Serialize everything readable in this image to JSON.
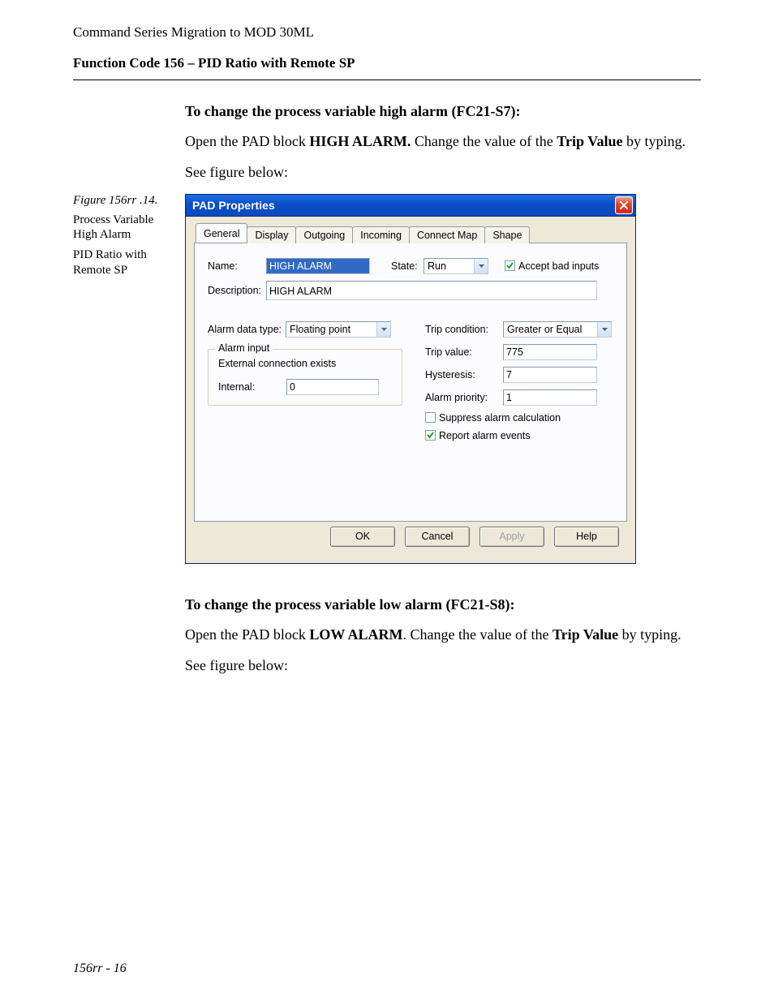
{
  "doc": {
    "header": "Command Series Migration to MOD 30ML",
    "section": "Function Code 156 – PID Ratio with Remote SP",
    "footer": "156rr - 16"
  },
  "highAlarm": {
    "heading": "To change the process variable high alarm (FC21-S7):",
    "para_pre": "Open the PAD block ",
    "para_bold1": "HIGH ALARM.",
    "para_mid": " Change the value of the ",
    "para_bold2": "Trip Value",
    "para_post": " by typing.",
    "seeFig": "See figure below:"
  },
  "figCaption": {
    "num": "Figure 156rr .14.",
    "line1": "Process Variable High Alarm",
    "line2": "PID Ratio with Remote SP"
  },
  "dialog": {
    "title": "PAD Properties",
    "tabs": [
      "General",
      "Display",
      "Outgoing",
      "Incoming",
      "Connect Map",
      "Shape"
    ],
    "labels": {
      "name": "Name:",
      "state": "State:",
      "acceptBad": "Accept bad inputs",
      "description": "Description:",
      "alarmDataType": "Alarm data type:",
      "alarmInputLegend": "Alarm input",
      "extConn": "External connection exists",
      "internal": "Internal:",
      "tripCond": "Trip condition:",
      "tripValue": "Trip value:",
      "hysteresis": "Hysteresis:",
      "alarmPriority": "Alarm priority:",
      "suppress": "Suppress alarm calculation",
      "report": "Report alarm events"
    },
    "values": {
      "name": "HIGH ALARM",
      "state": "Run",
      "description": "HIGH ALARM",
      "alarmDataType": "Floating point",
      "internal": "0",
      "tripCond": "Greater or Equal",
      "tripValue": "775",
      "hysteresis": "7",
      "alarmPriority": "1"
    },
    "buttons": {
      "ok": "OK",
      "cancel": "Cancel",
      "apply": "Apply",
      "help": "Help"
    }
  },
  "lowAlarm": {
    "heading": "To change the process variable low alarm (FC21-S8):",
    "para_pre": "Open the PAD block ",
    "para_bold1": "LOW ALARM",
    "para_mid": ". Change the value of the ",
    "para_bold2": "Trip Value",
    "para_post": " by typing.",
    "seeFig": "See figure below:"
  }
}
